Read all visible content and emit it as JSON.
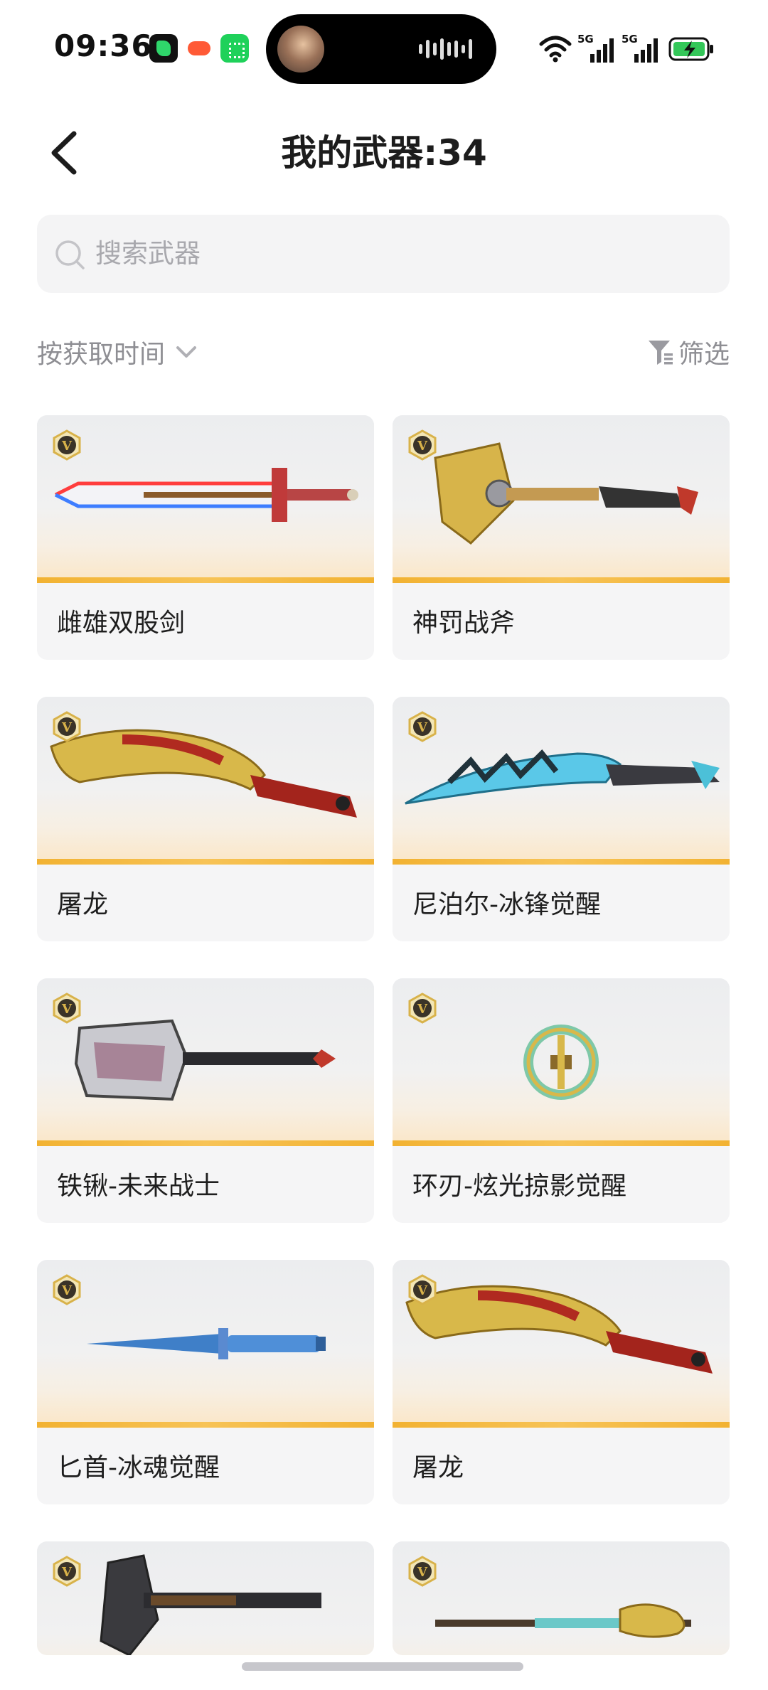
{
  "status_bar": {
    "time": "09:36",
    "app_icons": [
      "game-app-icon",
      "game-controller-icon",
      "store-app-icon"
    ],
    "network_labels": [
      "5G",
      "5G"
    ],
    "battery_state": "charging",
    "battery_color": "#34c759"
  },
  "header": {
    "title": "我的武器:34",
    "back_icon": "chevron-left-icon"
  },
  "search": {
    "placeholder": "搜索武器",
    "icon": "search-icon"
  },
  "sort": {
    "label": "按获取时间",
    "icon": "chevron-down-icon"
  },
  "filter": {
    "label": "筛选",
    "icon": "filter-icon"
  },
  "weapons": [
    {
      "name": "雌雄双股剑",
      "badge": "V"
    },
    {
      "name": "神罚战斧",
      "badge": "V"
    },
    {
      "name": "屠龙",
      "badge": "V"
    },
    {
      "name": "尼泊尔-冰锋觉醒",
      "badge": "V"
    },
    {
      "name": "铁锹-未来战士",
      "badge": "V"
    },
    {
      "name": "环刃-炫光掠影觉醒",
      "badge": "V"
    },
    {
      "name": "匕首-冰魂觉醒",
      "badge": "V"
    },
    {
      "name": "屠龙",
      "badge": "V"
    },
    {
      "name": "",
      "badge": "V"
    },
    {
      "name": "",
      "badge": "V"
    }
  ],
  "colors": {
    "card_bg": "#f5f5f6",
    "card_accent": "#f2b232",
    "badge_gold": "#d8b24a",
    "text_primary": "#1c1c1c",
    "text_secondary": "#8e8e93"
  }
}
